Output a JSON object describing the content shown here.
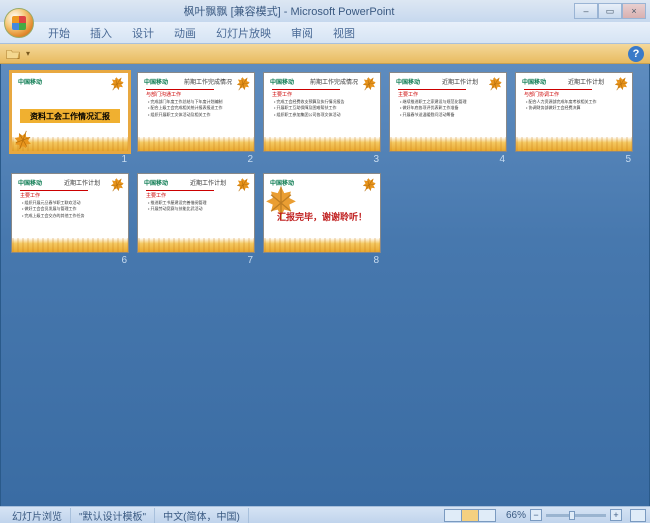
{
  "window": {
    "title": "枫叶飘飘 [兼容模式] - Microsoft PowerPoint",
    "min": "–",
    "max": "▭",
    "close": "×"
  },
  "tabs": [
    "开始",
    "插入",
    "设计",
    "动画",
    "幻灯片放映",
    "审阅",
    "视图"
  ],
  "qat_help": "?",
  "slides": [
    {
      "n": 1,
      "kind": "title",
      "title": "资料工会工作情况汇报",
      "logo": "中国移动",
      "sub": ""
    },
    {
      "n": 2,
      "kind": "content",
      "heading": "前期工作完成情况",
      "red": "与部门沟通工作",
      "bullets": [
        "完成部门年度工作总结与下年度计划编制",
        "配合上级工会完成相关统计报表报送工作",
        "组织开展职工文体活动及相关工作"
      ]
    },
    {
      "n": 3,
      "kind": "content",
      "heading": "前期工作完成情况",
      "red": "主要工作",
      "bullets": [
        "完成工会经费收支预算及执行情况报告",
        "开展职工互助保障及困难帮扶工作",
        "组织职工参加集团公司各项文体活动"
      ]
    },
    {
      "n": 4,
      "kind": "content",
      "heading": "近期工作计划",
      "red": "主要工作",
      "bullets": [
        "继续推进职工之家建设与规范化管理",
        "做好年底各项评优表彰工作准备",
        "开展春节送温暖慰问活动筹备"
      ]
    },
    {
      "n": 5,
      "kind": "content",
      "heading": "近期工作计划",
      "red": "与部门协调工作",
      "bullets": [
        "配合人力资源部完成年度考核相关工作",
        "协调财务部做好工会经费决算"
      ]
    },
    {
      "n": 6,
      "kind": "content",
      "heading": "近期工作计划",
      "red": "主要工作",
      "bullets": [
        "组织开展元旦春节职工联欢活动",
        "做好工会会员发展与管理工作",
        "完成上级工会交办的其他工作任务"
      ]
    },
    {
      "n": 7,
      "kind": "content",
      "heading": "近期工作计划",
      "red": "主要工作",
      "bullets": [
        "推进职工书屋建设完善借阅管理",
        "开展劳动竞赛与技能比武活动"
      ]
    },
    {
      "n": 8,
      "kind": "final",
      "text": "汇报完毕，谢谢聆听！"
    }
  ],
  "status": {
    "view": "幻灯片浏览",
    "theme": "\"默认设计模板\"",
    "lang": "中文(简体，中国)",
    "zoom": "66%"
  }
}
